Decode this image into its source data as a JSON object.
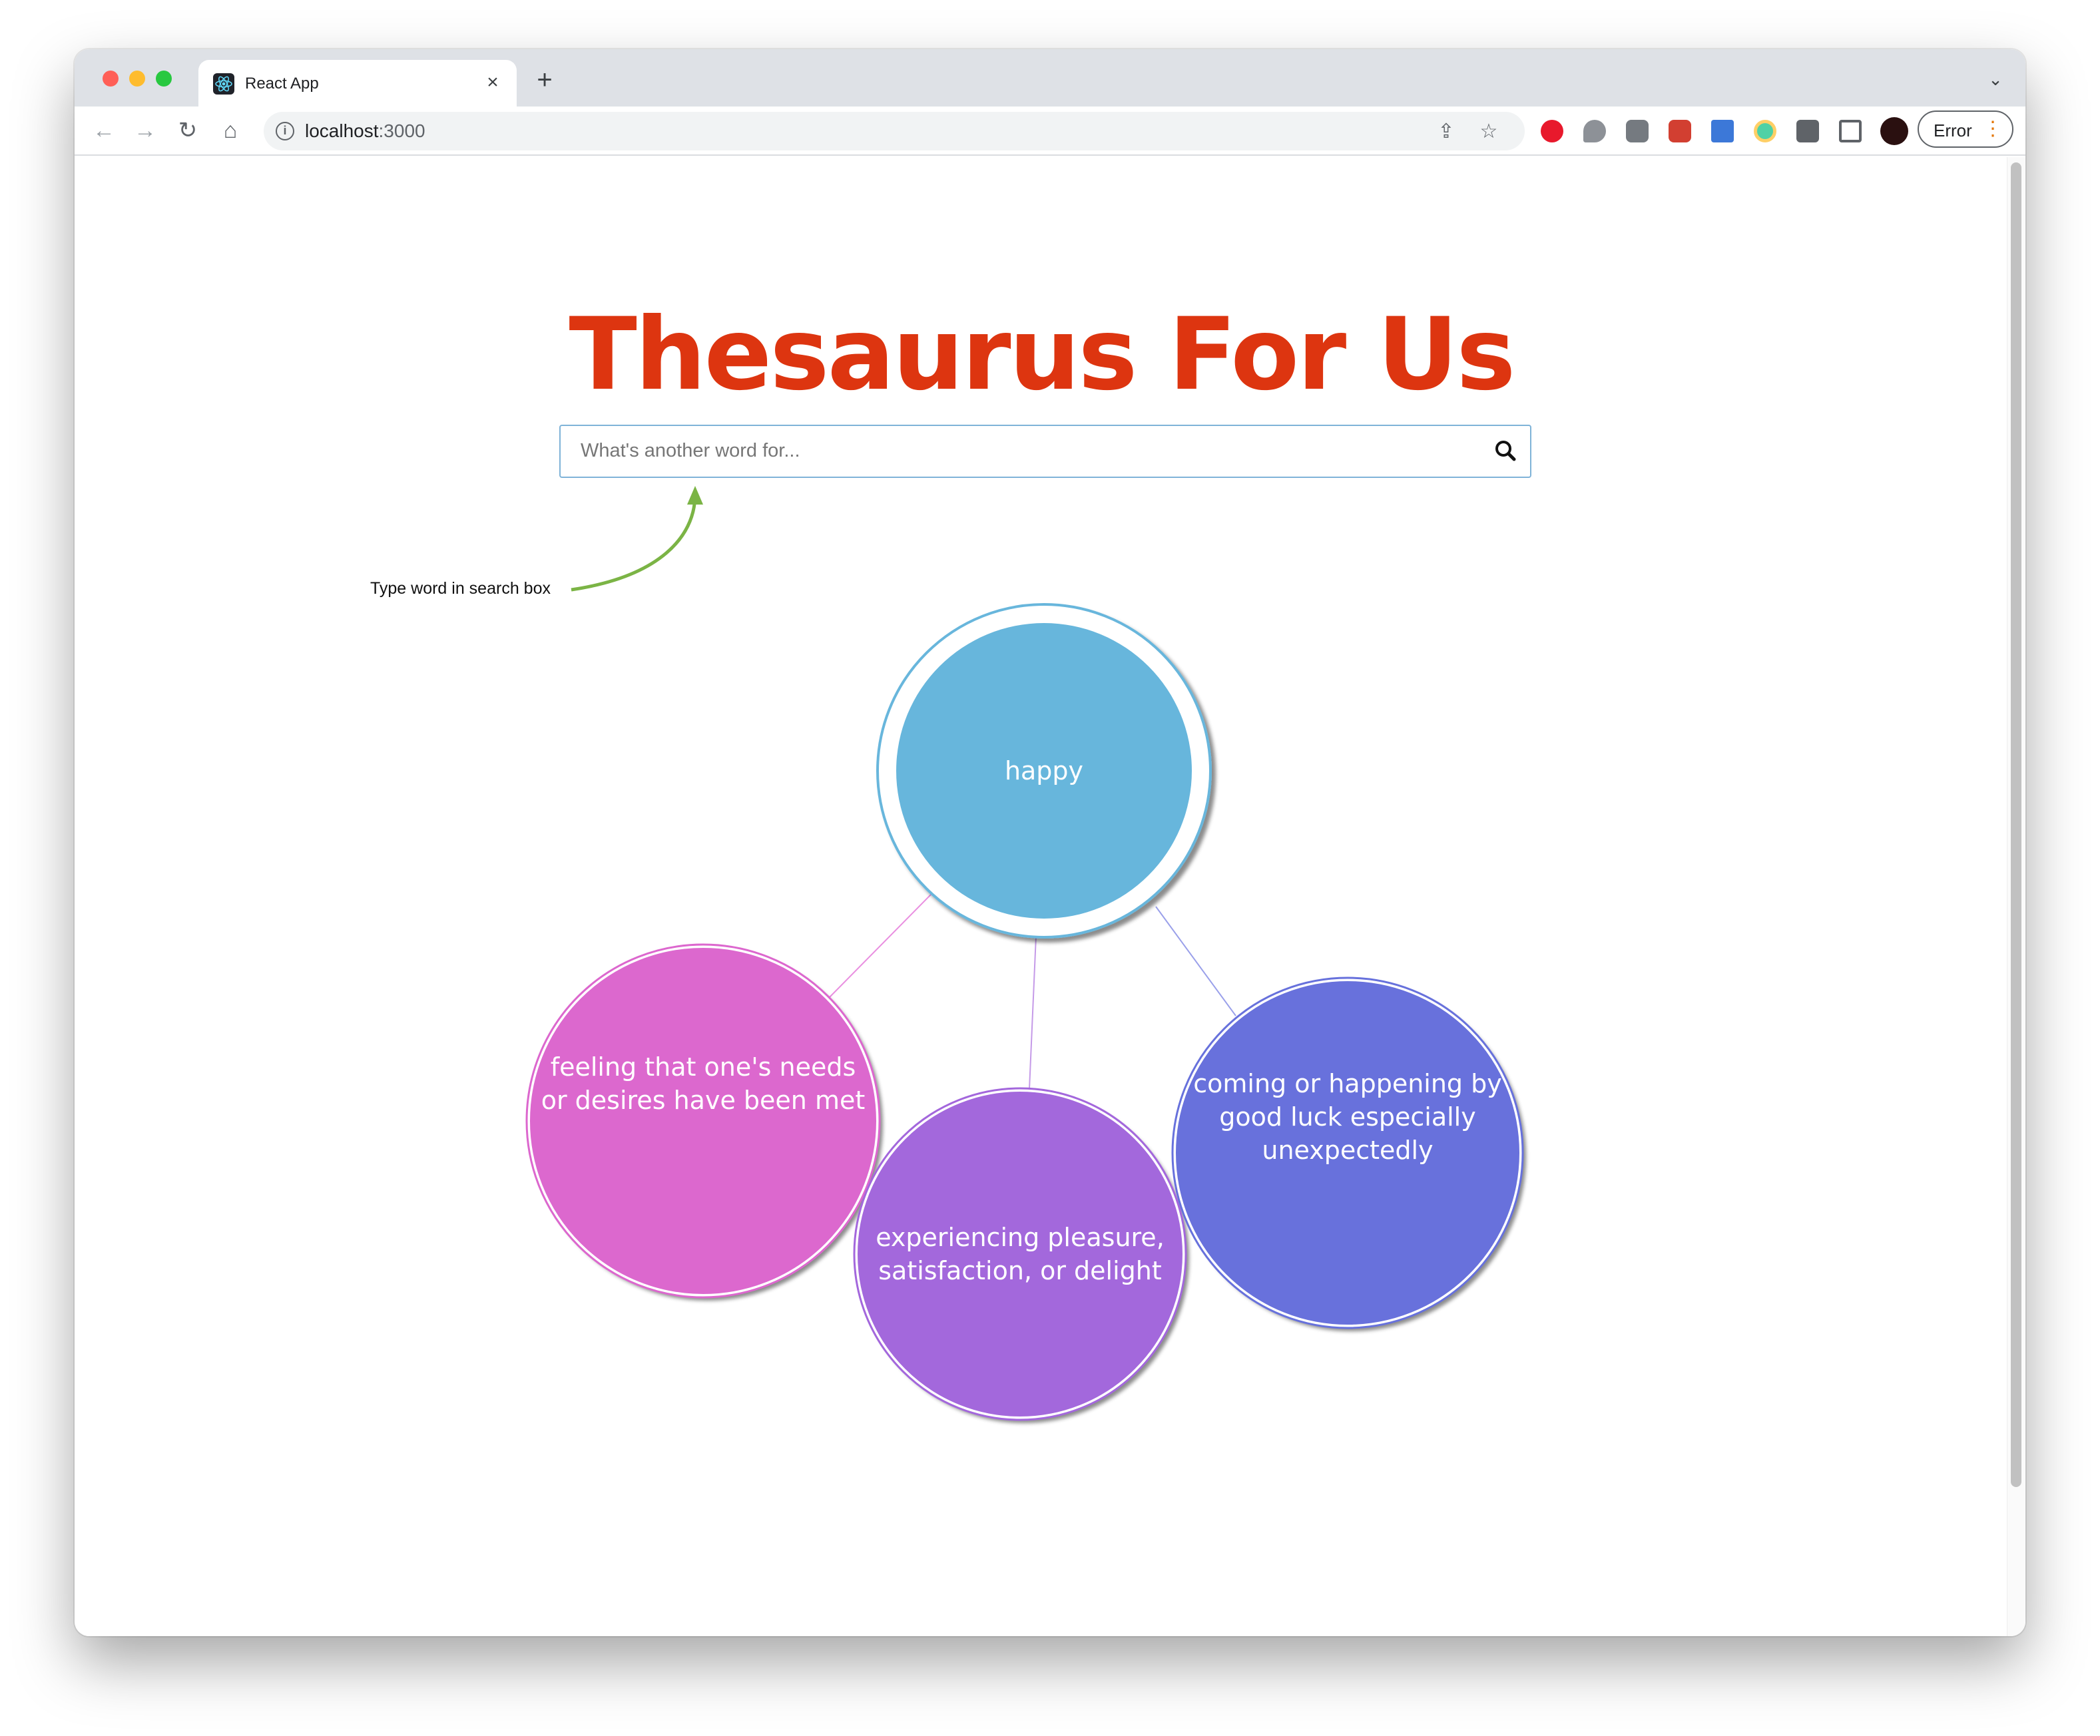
{
  "browser": {
    "tab_title": "React App",
    "tab_close": "×",
    "new_tab": "+",
    "tab_menu": "⌄",
    "back": "←",
    "forward": "→",
    "reload": "↻",
    "home": "⌂",
    "url_host": "localhost",
    "url_port": ":3000",
    "info": "i",
    "share": "⇪",
    "bookmark": "☆",
    "profile_status": "Error",
    "menu_dots": "⋮"
  },
  "page": {
    "title": "Thesaurus For Us",
    "search_placeholder": "What's another word for...",
    "search_value": "",
    "hint": "Type word in search box"
  },
  "graph": {
    "center": {
      "label": "happy",
      "color": "#67b6dc",
      "ring_color": "#67b6dc"
    },
    "nodes": [
      {
        "label": "feeling that one's needs or desires have been met",
        "color": "#dc67ce",
        "link_color": "#e98fe0"
      },
      {
        "label": "experiencing pleasure, satisfaction, or delight",
        "color": "#a367dc",
        "link_color": "#c59ae8"
      },
      {
        "label": "coming or happening by good luck especially unexpectedly",
        "color": "#6771dc",
        "link_color": "#9aa0ea"
      }
    ]
  },
  "colors": {
    "title": "#dd3510",
    "search_border": "#7fb3d8",
    "hint_arrow": "#7bb445"
  },
  "icons": {
    "search": "search-icon",
    "react_logo": "react-icon",
    "extensions": [
      "adblock-icon",
      "chat-bubble-icon",
      "password-manager-icon",
      "puzzle-game-icon",
      "folder-icon",
      "color-picker-icon",
      "extensions-puzzle-icon",
      "reading-list-icon",
      "avatar"
    ]
  }
}
